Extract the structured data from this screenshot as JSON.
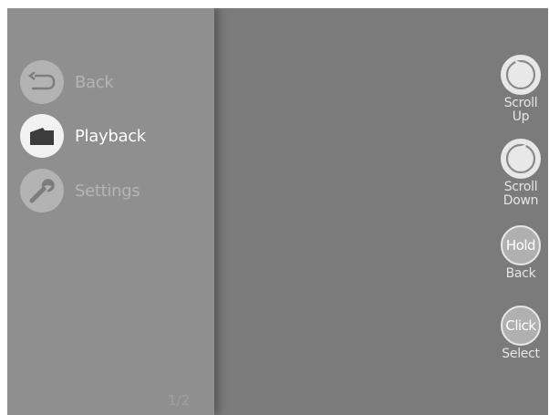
{
  "menu": {
    "items": [
      {
        "label": "Back",
        "icon": "back-arrow-icon",
        "active": false
      },
      {
        "label": "Playback",
        "icon": "folder-icon",
        "active": true
      },
      {
        "label": "Settings",
        "icon": "wrench-icon",
        "active": false
      }
    ],
    "page_indicator": "1/2"
  },
  "controls": {
    "scroll_up": {
      "label_line1": "Scroll",
      "label_line2": "Up",
      "icon": "rotate-counterclockwise-icon"
    },
    "scroll_down": {
      "label_line1": "Scroll",
      "label_line2": "Down",
      "icon": "rotate-clockwise-icon"
    },
    "hold_back": {
      "button_text": "Hold",
      "label": "Back"
    },
    "click_select": {
      "button_text": "Click",
      "label": "Select"
    }
  },
  "colors": {
    "panel": "#8f8f8f",
    "background": "#7b7b7b",
    "active_label": "#ffffff",
    "inactive_label": "#b5b5b5"
  }
}
